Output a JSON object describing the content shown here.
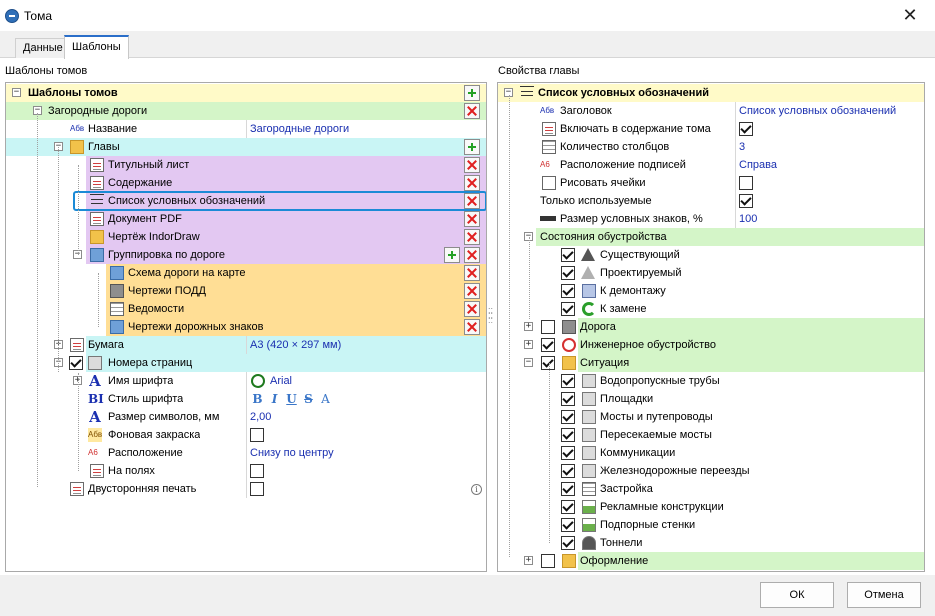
{
  "window": {
    "title": "Тома",
    "close_glyph": "✕"
  },
  "tabs": [
    {
      "label": "Данные",
      "active": false
    },
    {
      "label": "Шаблоны",
      "active": true
    }
  ],
  "left_panel": {
    "caption": "Шаблоны томов",
    "root": "Шаблоны томов",
    "group": "Загородные дороги",
    "name_label": "Название",
    "name_value": "Загородные дороги",
    "chapters": "Главы",
    "items": [
      "Титульный лист",
      "Содержание",
      "Список условных обозначений",
      "Документ PDF",
      "Чертёж IndorDraw",
      "Группировка по дороге"
    ],
    "subitems": [
      "Схема дороги на карте",
      "Чертежи ПОДД",
      "Ведомости",
      "Чертежи дорожных знаков"
    ],
    "paper_label": "Бумага",
    "paper_value": "А3 (420 × 297 мм)",
    "page_numbers": "Номера страниц",
    "font_name_label": "Имя шрифта",
    "font_name_value": "Arial",
    "font_style_label": "Стиль шрифта",
    "font_style_buttons": [
      "B",
      "I",
      "U",
      "S",
      "A"
    ],
    "size_label": "Размер символов, мм",
    "size_value": "2,00",
    "bg_label": "Фоновая закраска",
    "position_label": "Расположение",
    "position_value": "Снизу по центру",
    "margins_label": "На полях",
    "duplex_label": "Двусторонняя печать",
    "info_glyph": "i",
    "icon_text_abv": "Абв",
    "icon_text_a6": "А6",
    "icon_text_a": "A",
    "icon_text_bi": "BI"
  },
  "right_panel": {
    "caption": "Свойства главы",
    "root": "Список условных обозначений",
    "props": [
      {
        "label": "Заголовок",
        "value": "Список условных обозначений"
      },
      {
        "label": "Включать в содержание тома",
        "value": ""
      },
      {
        "label": "Количество столбцов",
        "value": "3"
      },
      {
        "label": "Расположение подписей",
        "value": "Справа"
      },
      {
        "label": "Рисовать ячейки",
        "value": ""
      },
      {
        "label": "Только используемые",
        "value": ""
      },
      {
        "label": "Размер условных знаков, %",
        "value": "100"
      }
    ],
    "states_group": "Состояния обустройства",
    "states": [
      "Существующий",
      "Проектируемый",
      "К демонтажу",
      "К замене"
    ],
    "road": "Дорога",
    "engineering": "Инженерное обустройство",
    "situation": "Ситуация",
    "situation_items": [
      "Водопропускные трубы",
      "Площадки",
      "Мосты и путепроводы",
      "Пересекаемые мосты",
      "Коммуникации",
      "Железнодорожные переезды",
      "Застройка",
      "Рекламные конструкции",
      "Подпорные стенки",
      "Тоннели"
    ],
    "design": "Оформление"
  },
  "footer": {
    "ok": "ОК",
    "cancel": "Отмена"
  },
  "colors": {
    "accent": "#2a6ec9",
    "yellow": "#fffac8",
    "green": "#d4f5c8",
    "cyan": "#c9f5f5",
    "purple": "#e3c8f2",
    "orange": "#ffde95"
  }
}
